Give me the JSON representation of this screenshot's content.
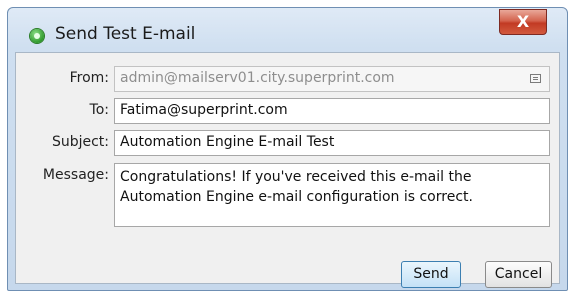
{
  "window": {
    "title": "Send Test E-mail",
    "close_label": "X",
    "app_icon": "green-circle-icon"
  },
  "form": {
    "from": {
      "label": "From:",
      "value": "admin@mailserv01.city.superprint.com",
      "icon": "list-icon"
    },
    "to": {
      "label": "To:",
      "value": "Fatima@superprint.com"
    },
    "subject": {
      "label": "Subject:",
      "value": "Automation Engine E-mail Test"
    },
    "message": {
      "label": "Message:",
      "line1": "Congratulations! If you've received this e-mail the",
      "line2": "Automation Engine e-mail configuration is correct."
    }
  },
  "buttons": {
    "send": "Send",
    "cancel": "Cancel"
  }
}
